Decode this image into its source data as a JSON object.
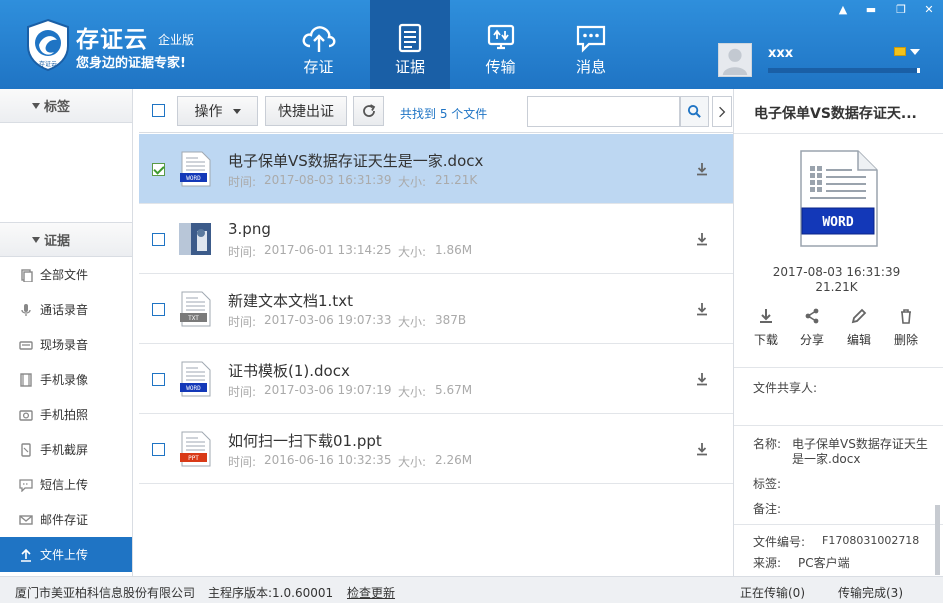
{
  "app": {
    "brand_name": "存证云",
    "edition": "企业版",
    "slogan": "您身边的证据专家!",
    "logo_text": "存证云"
  },
  "nav": [
    {
      "label": "存证",
      "icon": "cloud-upload-icon"
    },
    {
      "label": "证据",
      "icon": "document-icon",
      "active": true
    },
    {
      "label": "传输",
      "icon": "transfer-icon"
    },
    {
      "label": "消息",
      "icon": "message-icon"
    }
  ],
  "user": {
    "name": "xxx",
    "storage_used_fraction": 0.98
  },
  "window": {
    "minimize": "▬",
    "restore": "❐",
    "close": "✕",
    "menu": "▲"
  },
  "sidebar": {
    "tags_header": "标签",
    "evidence_header": "证据",
    "items": [
      {
        "label": "全部文件",
        "icon": "files-icon"
      },
      {
        "label": "通话录音",
        "icon": "microphone-icon"
      },
      {
        "label": "现场录音",
        "icon": "recorder-icon"
      },
      {
        "label": "手机录像",
        "icon": "film-icon"
      },
      {
        "label": "手机拍照",
        "icon": "camera-icon"
      },
      {
        "label": "手机截屏",
        "icon": "screenshot-icon"
      },
      {
        "label": "短信上传",
        "icon": "sms-icon"
      },
      {
        "label": "邮件存证",
        "icon": "mail-icon"
      },
      {
        "label": "文件上传",
        "icon": "upload-icon",
        "active": true
      }
    ]
  },
  "toolbar": {
    "action_label": "操作",
    "quick_label": "快捷出证",
    "found_text": "共找到 5 个文件",
    "search_placeholder": ""
  },
  "files": [
    {
      "name": "电子保单VS数据存证天生是一家.docx",
      "time_label": "时间:",
      "time": "2017-08-03 16:31:39",
      "size_label": "大小:",
      "size": "21.21K",
      "type": "WORD",
      "selected": true
    },
    {
      "name": "3.png",
      "time_label": "时间:",
      "time": "2017-06-01 13:14:25",
      "size_label": "大小:",
      "size": "1.86M",
      "type": "IMAGE",
      "selected": false
    },
    {
      "name": "新建文本文档1.txt",
      "time_label": "时间:",
      "time": "2017-03-06 19:07:33",
      "size_label": "大小:",
      "size": "387B",
      "type": "TXT",
      "selected": false
    },
    {
      "name": "证书模板(1).docx",
      "time_label": "时间:",
      "time": "2017-03-06 19:07:19",
      "size_label": "大小:",
      "size": "5.67M",
      "type": "WORD",
      "selected": false
    },
    {
      "name": "如何扫一扫下载01.ppt",
      "time_label": "时间:",
      "time": "2016-06-16 10:32:35",
      "size_label": "大小:",
      "size": "2.26M",
      "type": "PPT",
      "selected": false
    }
  ],
  "detail": {
    "title": "电子保单VS数据存证天...",
    "icon_type": "WORD",
    "date": "2017-08-03 16:31:39",
    "size": "21.21K",
    "actions": [
      {
        "label": "下载",
        "icon": "download-icon"
      },
      {
        "label": "分享",
        "icon": "share-icon"
      },
      {
        "label": "编辑",
        "icon": "edit-icon"
      },
      {
        "label": "删除",
        "icon": "trash-icon"
      }
    ],
    "sharer_label": "文件共享人:",
    "name_label": "名称:",
    "name_value_line1": "电子保单VS数据存证天生",
    "name_value_line2": "是一家.docx",
    "tag_label": "标签:",
    "note_label": "备注:",
    "number_label": "文件编号:",
    "number_value": "F1708031002718",
    "source_label": "来源:",
    "source_value": "PC客户端"
  },
  "status": {
    "company": "厦门市美亚柏科信息股份有限公司",
    "version": "主程序版本:1.0.60001",
    "check_update": "检查更新",
    "uploading": "正在传输(0)",
    "done": "传输完成(3)"
  }
}
